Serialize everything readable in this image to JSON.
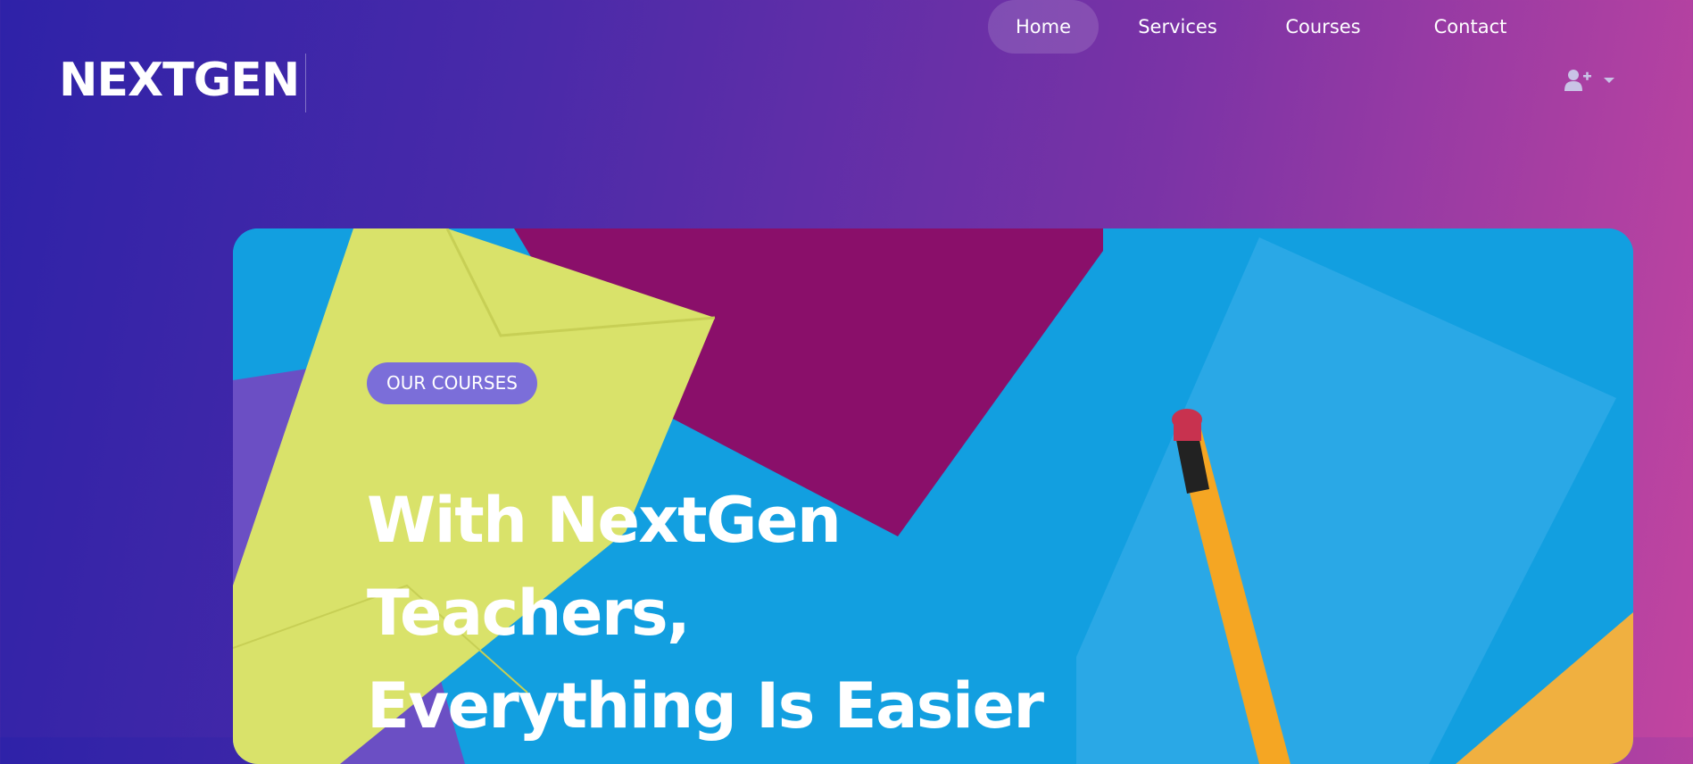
{
  "brand": {
    "name": "NEXTGEN"
  },
  "nav": {
    "items": [
      {
        "label": "Home",
        "active": true
      },
      {
        "label": "Services",
        "active": false
      },
      {
        "label": "Courses",
        "active": false
      },
      {
        "label": "Contact",
        "active": false
      }
    ],
    "user_icon": "user-plus-icon",
    "dropdown_icon": "caret-down-icon"
  },
  "hero": {
    "badge": "OUR COURSES",
    "title_lines": [
      "With NextGen",
      "Teachers,",
      "Everything Is Easier"
    ],
    "image": "colorful-envelopes-and-pencil"
  },
  "colors": {
    "gradient_start": "#2e22a8",
    "gradient_end": "#c245a0",
    "badge": "#7b6ed9",
    "hero_blue": "#129fe0",
    "envelope_yellow": "#d9e26a",
    "envelope_magenta": "#8a0f6a",
    "pencil_orange": "#f5a623"
  }
}
